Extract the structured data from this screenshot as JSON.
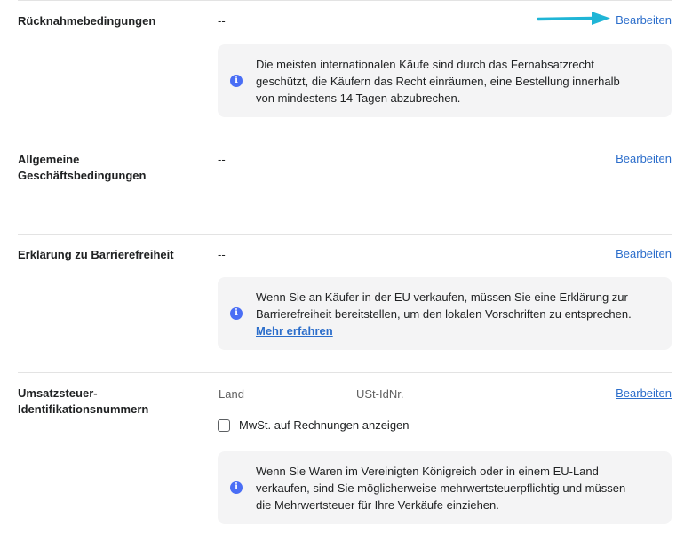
{
  "sections": {
    "returns": {
      "label": "Rücknahmebedingungen",
      "value": "--",
      "edit": "Bearbeiten",
      "info": "Die meisten internationalen Käufe sind durch das Fernabsatzrecht geschützt, die Käufern das Recht einräumen, eine Bestellung innerhalb von mindestens 14 Tagen abzubrechen."
    },
    "terms": {
      "label": "Allgemeine Geschäftsbedingungen",
      "value": "--",
      "edit": "Bearbeiten"
    },
    "accessibility": {
      "label": "Erklärung zu Barrierefreiheit",
      "value": "--",
      "edit": "Bearbeiten",
      "info": "Wenn Sie an Käufer in der EU verkaufen, müssen Sie eine Erklärung zur Barrierefreiheit bereitstellen, um den lokalen Vorschriften zu entsprechen.",
      "link": "Mehr erfahren"
    },
    "vat": {
      "label": "Umsatzsteuer-Identifikationsnummern",
      "col_country": "Land",
      "col_vat_id": "USt-IdNr.",
      "edit": "Bearbeiten",
      "checkbox_label": "MwSt. auf Rechnungen anzeigen",
      "checkbox_checked": false,
      "info": "Wenn Sie Waren im Vereinigten Königreich oder in einem EU-Land verkaufen, sind Sie möglicherweise mehrwertsteuerpflichtig und müssen die Mehrwertsteuer für Ihre Verkäufe einziehen."
    }
  },
  "icons": {
    "info": "info-icon",
    "annotation": "arrow-right-icon"
  },
  "colors": {
    "link": "#2c6ecb",
    "info_icon": "#4a6ef5",
    "info_bg": "#f4f4f5",
    "annotation_arrow": "#1fb5d6"
  }
}
